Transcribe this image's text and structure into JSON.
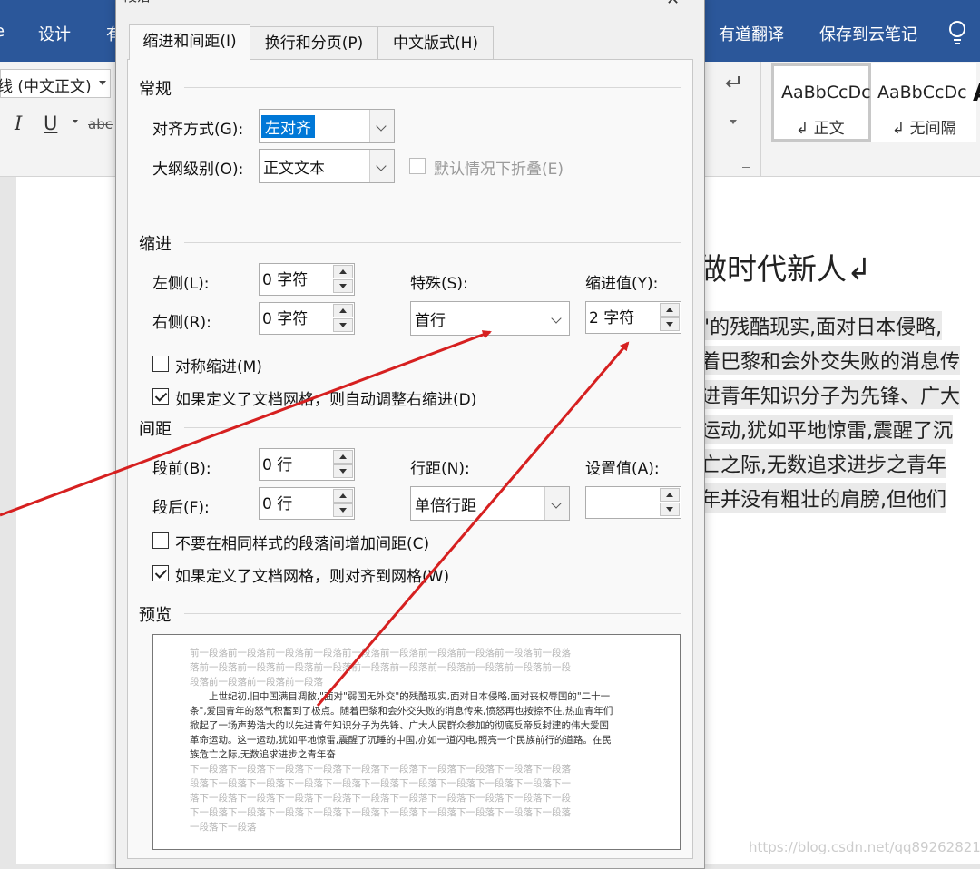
{
  "ribbon": {
    "tabs": [
      "设计",
      "有",
      "有道翻译",
      "保存到云笔记"
    ],
    "font_name": "线 (中文正文)",
    "format_glyphs": [
      "I",
      "U",
      "abc"
    ],
    "styles": [
      {
        "sample": "AaBbCcDc",
        "name": "↲ 正文"
      },
      {
        "sample": "AaBbCcDc",
        "name": "↲ 无间隔"
      }
    ],
    "colors": {
      "ribbon_blue": "#2b579a",
      "arrow_red": "#d62020"
    }
  },
  "document": {
    "heading": "做时代新人↲",
    "lines": [
      "\"的残酷现实,面对日本侵略,",
      "着巴黎和会外交失败的消息传",
      "进青年知识分子为先锋、广大",
      "运动,犹如平地惊雷,震醒了沉",
      "亡之际,无数追求进步之青年",
      "年并没有粗壮的肩膀,但他们"
    ]
  },
  "dialog": {
    "title": "段落",
    "tabs": [
      "缩进和间距(I)",
      "换行和分页(P)",
      "中文版式(H)"
    ],
    "general": {
      "section": "常规",
      "alignment_label": "对齐方式(G):",
      "alignment_value": "左对齐",
      "outline_label": "大纲级别(O):",
      "outline_value": "正文文本",
      "collapse_label": "默认情况下折叠(E)"
    },
    "indent": {
      "section": "缩进",
      "left_label": "左侧(L):",
      "left_value": "0 字符",
      "right_label": "右侧(R):",
      "right_value": "0 字符",
      "special_label": "特殊(S):",
      "special_value": "首行",
      "by_label": "缩进值(Y):",
      "by_value": "2 字符",
      "mirror_label": "对称缩进(M)",
      "auto_adjust_label": "如果定义了文档网格，则自动调整右缩进(D)"
    },
    "spacing": {
      "section": "间距",
      "before_label": "段前(B):",
      "before_value": "0 行",
      "after_label": "段后(F):",
      "after_value": "0 行",
      "line_label": "行距(N):",
      "line_value": "单倍行距",
      "at_label": "设置值(A):",
      "at_value": "",
      "no_space_label": "不要在相同样式的段落间增加间距(C)",
      "snap_grid_label": "如果定义了文档网格，则对齐到网格(W)"
    },
    "preview": {
      "section": "预览",
      "prev_lines": [
        "前一段落前一段落前一段落前一段落前一段落前一段落前一段落前一段落前一段落前一段落",
        "落前一段落前一段落前一段落前一段落前一段落前一段落前一段落前一段落前一段落前一段",
        "段落前一段落前一段落前一段落"
      ],
      "body_lines": [
        "　　上世纪初,旧中国满目凋敝,\"面对\"弱国无外交\"的残酷现实,面对日本侵略,面对丧权辱国的\"二十一",
        "条\",爱国青年的怒气积蓄到了极点。随着巴黎和会外交失败的消息传来,愤怒再也按捺不住,热血青年们",
        "掀起了一场声势浩大的以先进青年知识分子为先锋、广大人民群众参加的彻底反帝反封建的伟大爱国",
        "革命运动。这一运动,犹如平地惊雷,震醒了沉睡的中国,亦如一道闪电,照亮一个民族前行的道路。在民",
        "族危亡之际,无数追求进步之青年奋"
      ],
      "next_lines": [
        "下一段落下一段落下一段落下一段落下一段落下一段落下一段落下一段落下一段落下一段落",
        "段落下一段落下一段落下一段落下一段落下一段落下一段落下一段落下一段落下一段落下一",
        "落下一段落下一段落下一段落下一段落下一段落下一段落下一段落下一段落下一段落下一段",
        "下一段落下一段落下一段落下一段落下一段落下一段落下一段落下一段落下一段落下一段落",
        "一段落下一段落"
      ]
    }
  },
  "watermark": "https://blog.csdn.net/qq892628217"
}
